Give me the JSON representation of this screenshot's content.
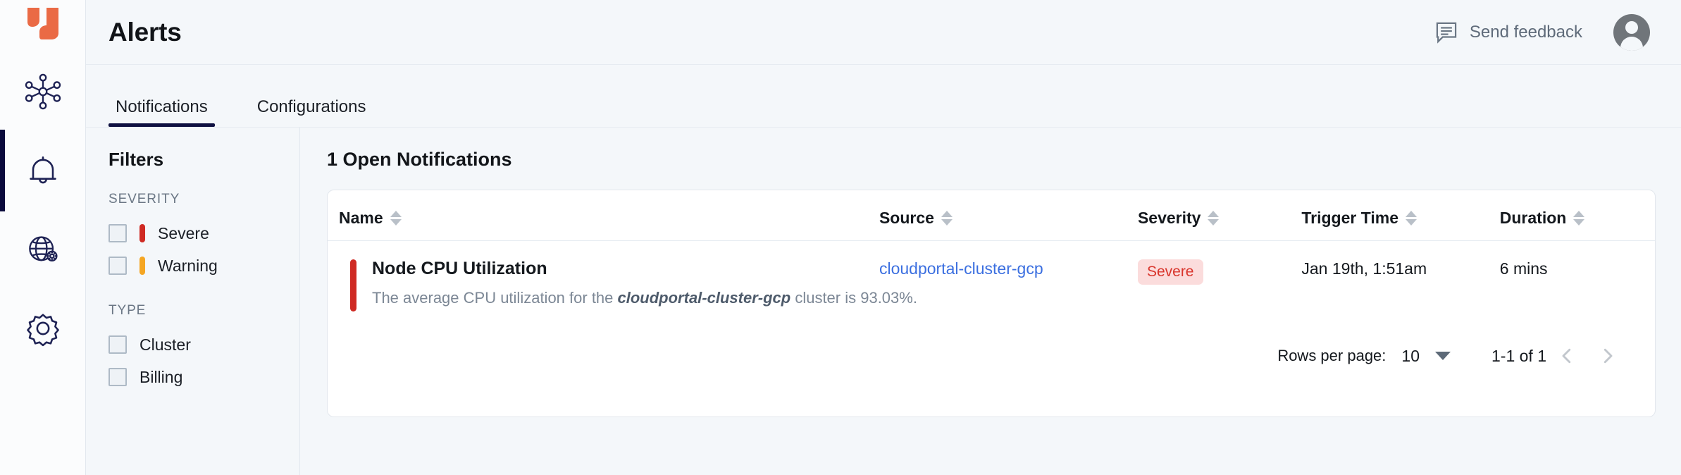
{
  "brand": {
    "logo_icon": "yugabyte-logo-icon",
    "accent": "#ea6a45"
  },
  "rail": {
    "items": [
      {
        "icon": "cluster-network-icon",
        "name": "clusters",
        "active": false
      },
      {
        "icon": "bell-icon",
        "name": "alerts",
        "active": true
      },
      {
        "icon": "globe-gear-icon",
        "name": "network-settings",
        "active": false
      },
      {
        "icon": "gear-icon",
        "name": "settings",
        "active": false
      }
    ]
  },
  "header": {
    "title": "Alerts",
    "feedback_label": "Send feedback",
    "feedback_icon": "feedback-message-icon",
    "avatar_icon": "user-avatar-icon"
  },
  "tabs": [
    {
      "label": "Notifications",
      "active": true
    },
    {
      "label": "Configurations",
      "active": false
    }
  ],
  "filters": {
    "title": "Filters",
    "groups": [
      {
        "label": "SEVERITY",
        "options": [
          {
            "label": "Severe",
            "color": "#cf2a23",
            "checked": false
          },
          {
            "label": "Warning",
            "color": "#f5a623",
            "checked": false
          }
        ]
      },
      {
        "label": "TYPE",
        "options": [
          {
            "label": "Cluster",
            "color": null,
            "checked": false
          },
          {
            "label": "Billing",
            "color": null,
            "checked": false
          }
        ]
      }
    ]
  },
  "main": {
    "heading": "1 Open Notifications",
    "columns": [
      {
        "label": "Name",
        "sortable": true
      },
      {
        "label": "Source",
        "sortable": true
      },
      {
        "label": "Severity",
        "sortable": true
      },
      {
        "label": "Trigger Time",
        "sortable": true
      },
      {
        "label": "Duration",
        "sortable": true
      }
    ],
    "rows": [
      {
        "severity_color": "#cf2a23",
        "name": "Node CPU Utilization",
        "description_prefix": "The average CPU utilization for the ",
        "description_emphasis": "cloudportal-cluster-gcp",
        "description_suffix": " cluster is 93.03%.",
        "source": "cloudportal-cluster-gcp",
        "severity": "Severe",
        "trigger_time": "Jan 19th, 1:51am",
        "duration": "6 mins"
      }
    ],
    "pagination": {
      "rows_per_page_label": "Rows per page:",
      "rows_per_page_value": "10",
      "range": "1-1 of 1",
      "prev_icon": "chevron-left-icon",
      "next_icon": "chevron-right-icon"
    }
  }
}
